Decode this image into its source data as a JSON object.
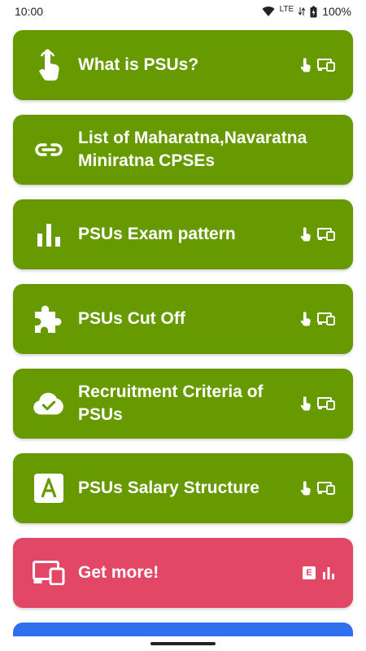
{
  "status_bar": {
    "time": "10:00",
    "network": "LTE",
    "battery": "100%"
  },
  "colors": {
    "card_green": "#679a00",
    "card_pink": "#e34766",
    "card_blue": "#2f6ff0"
  },
  "menu": {
    "items": [
      {
        "label": "What is PSUs?",
        "icon": "tap-hand-icon"
      },
      {
        "label": "List of Maharatna,Navaratna Miniratna CPSEs",
        "icon": "link-icon"
      },
      {
        "label": "PSUs Exam pattern",
        "icon": "bar-chart-icon"
      },
      {
        "label": "PSUs Cut Off",
        "icon": "puzzle-icon"
      },
      {
        "label": "Recruitment Criteria of PSUs",
        "icon": "cloud-check-icon"
      },
      {
        "label": "PSUs Salary Structure",
        "icon": "letter-a-icon"
      }
    ],
    "get_more": {
      "label": "Get more!",
      "icon": "devices-icon",
      "badge": "E"
    }
  }
}
